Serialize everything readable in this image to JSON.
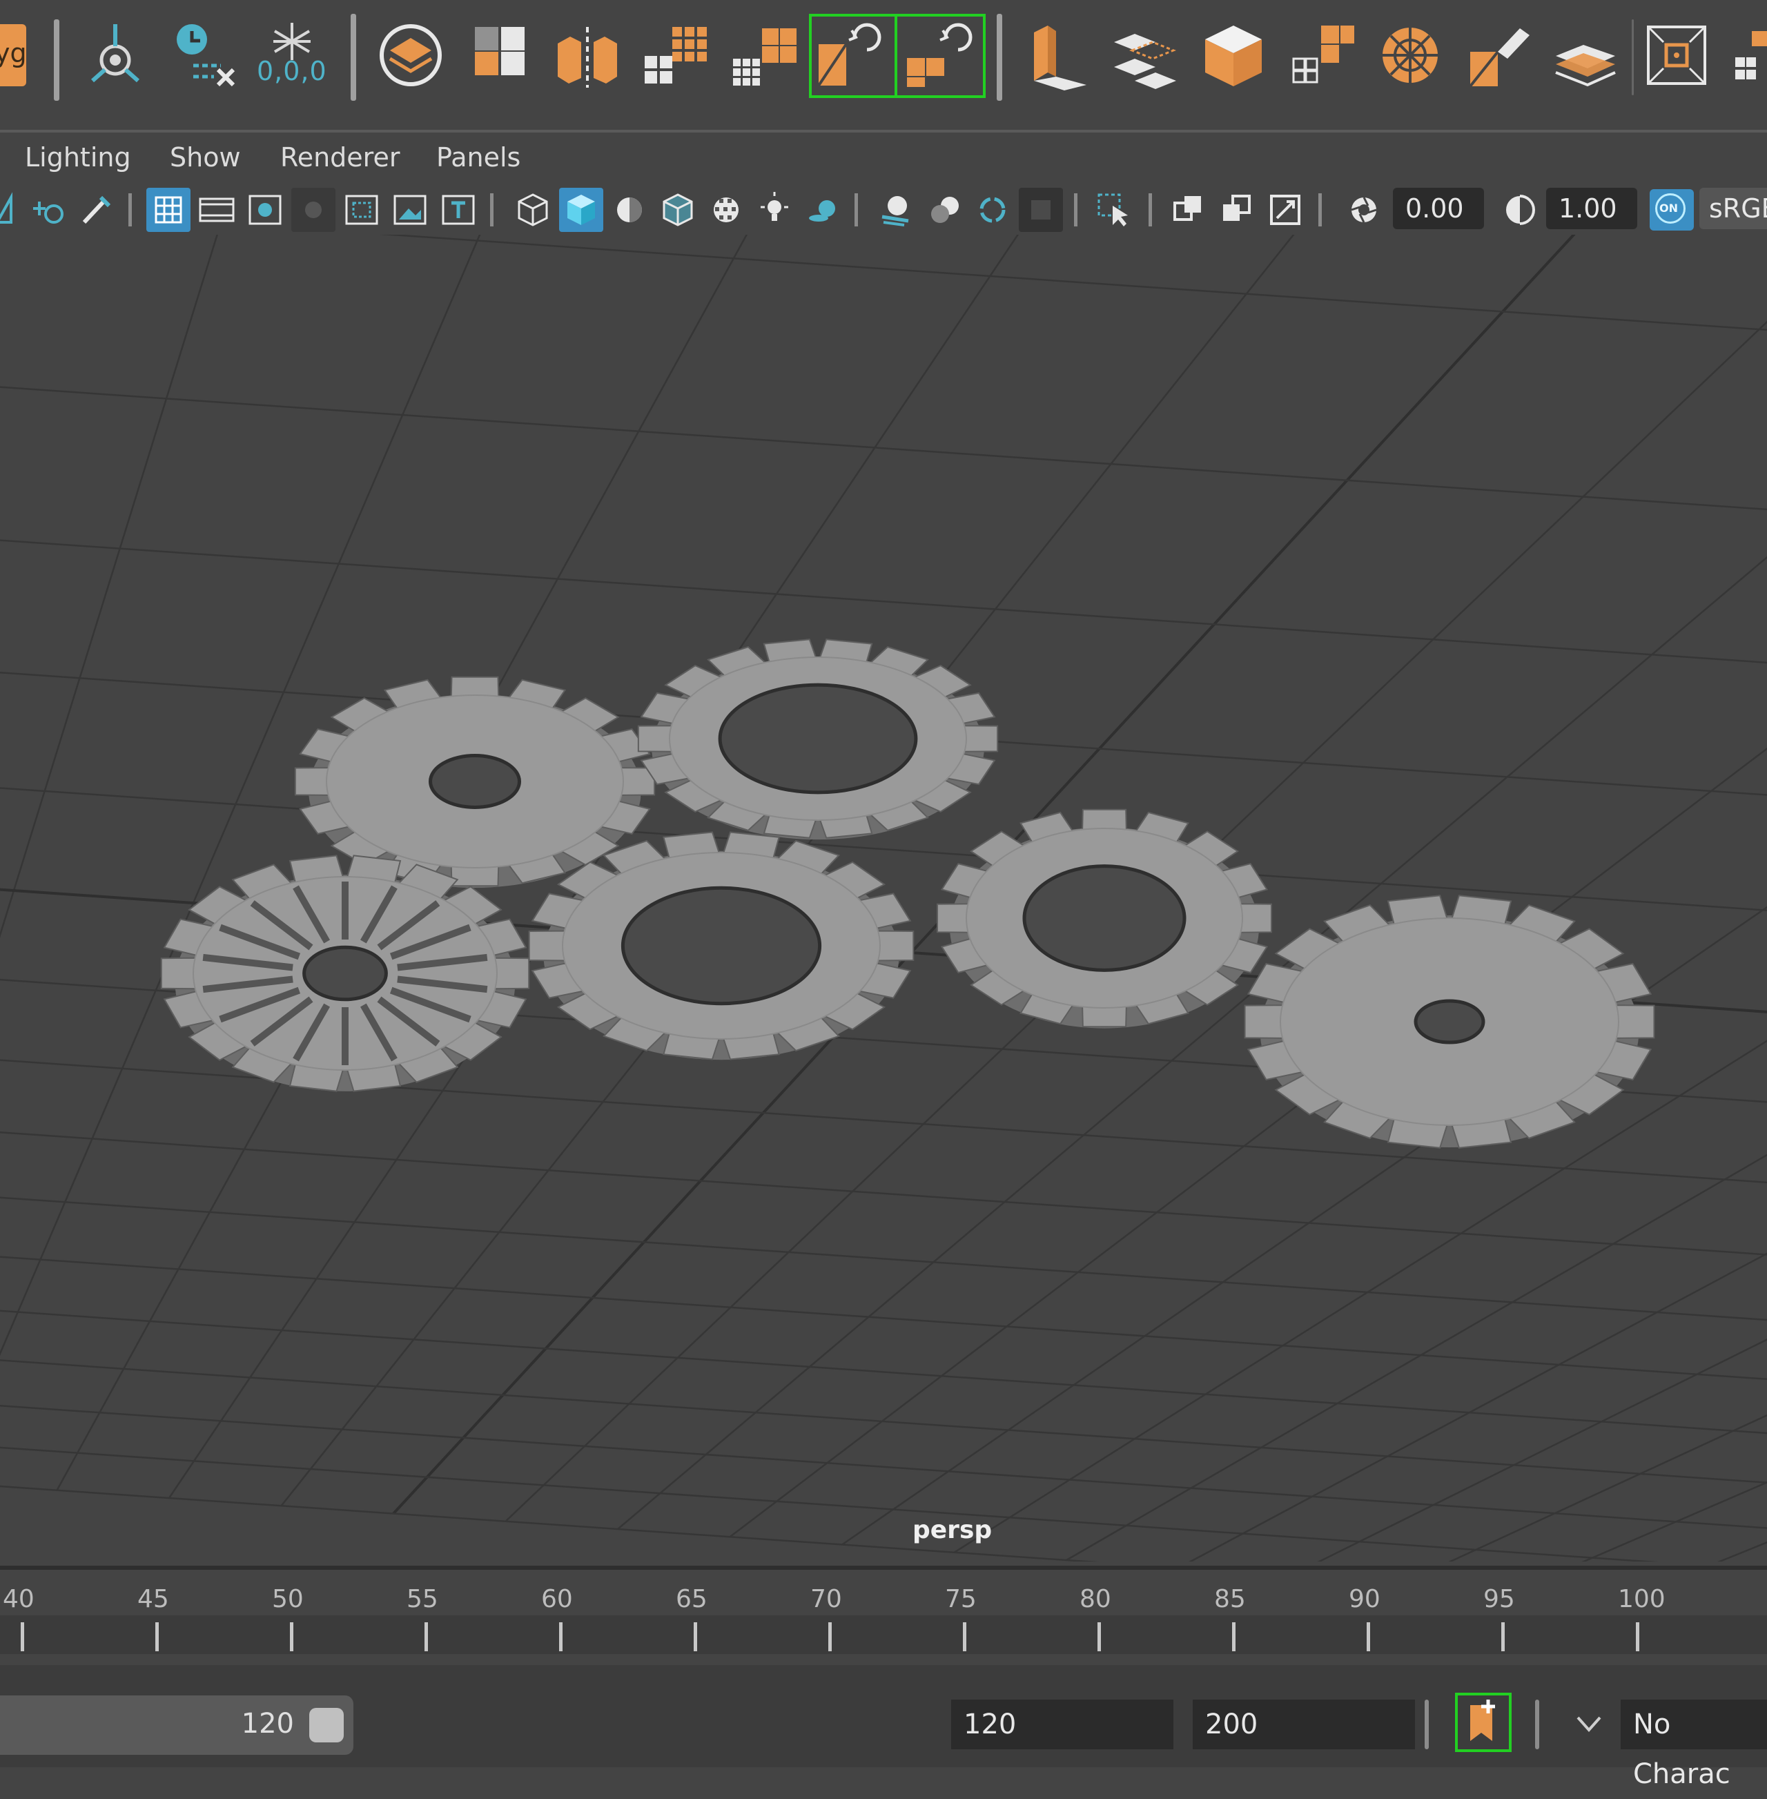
{
  "shelf": {
    "left_label": "yg",
    "origin_readout": "0,0,0",
    "icons": [
      "center-pivot-icon",
      "delete-history-icon",
      "freeze-transform-icon",
      "make-live-icon",
      "combine-icon",
      "mirror-icon",
      "extract-icon",
      "smooth-icon",
      "booleans-union-icon",
      "booleans-difference-icon",
      "extrude-icon",
      "bridge-icon",
      "bevel-icon",
      "insert-edgeloop-icon",
      "multi-cut-icon",
      "merge-icon",
      "quad-draw-icon",
      "snap-icon",
      "grid-icon"
    ]
  },
  "menubar": {
    "items": [
      "Lighting",
      "Show",
      "Renderer",
      "Panels"
    ]
  },
  "panel_toolbar": {
    "exposure_value": "0.00",
    "gamma_value": "1.00",
    "color_management": "sRGB",
    "on_badge": "ON"
  },
  "viewport": {
    "camera": "persp",
    "background": "#444444",
    "grid_color": "#363636",
    "object_color": "#9a9a9a"
  },
  "timeline": {
    "ticks": [
      "40",
      "45",
      "50",
      "55",
      "60",
      "65",
      "70",
      "75",
      "80",
      "85",
      "90",
      "95",
      "100"
    ]
  },
  "range": {
    "slider_end": "120",
    "playback_end": "120",
    "animation_end": "200",
    "character_set": "No Charac"
  },
  "colors": {
    "accent_orange": "#e8964c",
    "accent_teal": "#4fb3c9",
    "selection_green": "#22d022",
    "toolbar_active": "#3b8fc4"
  }
}
